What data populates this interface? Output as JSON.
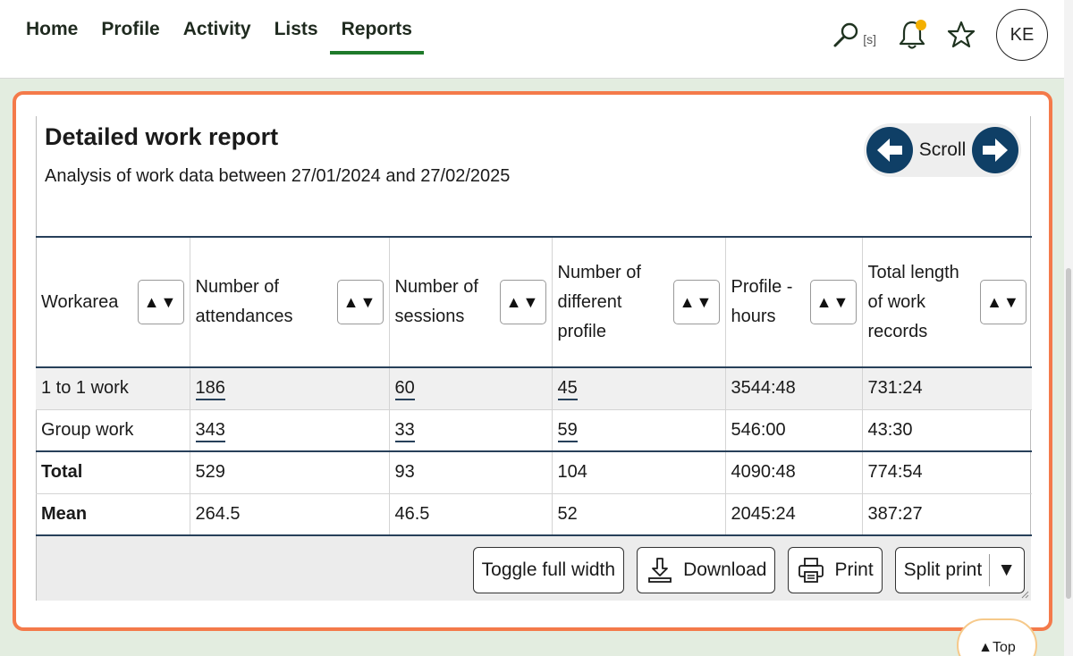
{
  "nav": {
    "items": [
      {
        "label": "Home"
      },
      {
        "label": "Profile"
      },
      {
        "label": "Activity"
      },
      {
        "label": "Lists"
      },
      {
        "label": "Reports",
        "active": true
      }
    ]
  },
  "header_tools": {
    "search_icon": "search-icon",
    "search_shortcut": "[s]",
    "notification_icon": "bell-icon",
    "notification_dot_color": "#f4b000",
    "favourite_icon": "star-icon",
    "avatar_initials": "KE"
  },
  "report": {
    "title": "Detailed work report",
    "subtitle": "Analysis of work data between 27/01/2024 and 27/02/2025",
    "scroll_label": "Scroll",
    "columns": [
      "Workarea",
      "Number of attendances",
      "Number of sessions",
      "Number of different profile",
      "Profile - hours",
      "Total length of work records"
    ],
    "sort_label": "▲▼",
    "rows": [
      {
        "workarea": "1 to 1 work",
        "attendances": "186",
        "sessions": "60",
        "profiles": "45",
        "hours": "3544:48",
        "length": "731:24"
      },
      {
        "workarea": "Group work",
        "attendances": "343",
        "sessions": "33",
        "profiles": "59",
        "hours": "546:00",
        "length": "43:30"
      }
    ],
    "total": {
      "label": "Total",
      "attendances": "529",
      "sessions": "93",
      "profiles": "104",
      "hours": "4090:48",
      "length": "774:54"
    },
    "mean": {
      "label": "Mean",
      "attendances": "264.5",
      "sessions": "46.5",
      "profiles": "52",
      "hours": "2045:24",
      "length": "387:27"
    }
  },
  "actions": {
    "toggle_full_width": "Toggle full width",
    "download": "Download",
    "print": "Print",
    "split_print": "Split print",
    "split_arrow": "▼"
  },
  "top_button": "▲Top",
  "colors": {
    "highlight_border": "#f47a4a",
    "active_nav_underline": "#1e7a2a",
    "arrow_button": "#0f3f66",
    "page_background": "#e3ede0"
  }
}
